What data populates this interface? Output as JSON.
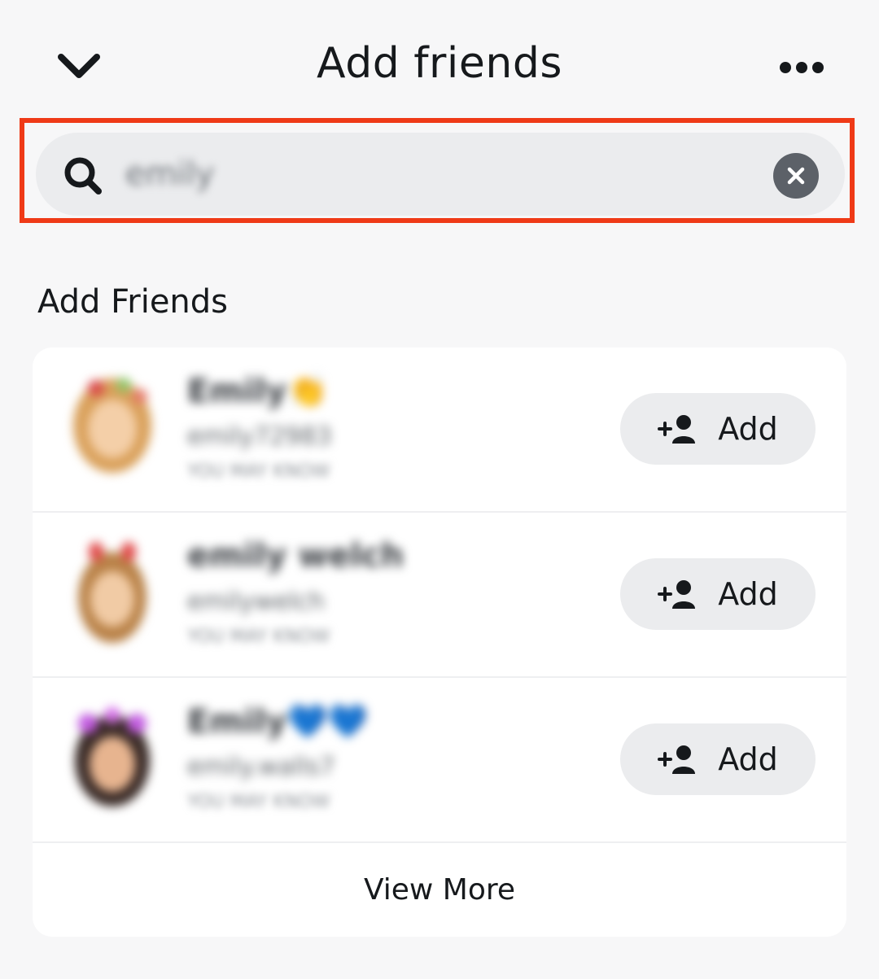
{
  "header": {
    "title": "Add friends",
    "back_icon": "chevron-down-icon",
    "more_icon": "more-horizontal-icon"
  },
  "search": {
    "value": "emily",
    "search_icon": "search-icon",
    "clear_icon": "clear-icon",
    "highlight_color": "#ef3a17"
  },
  "section": {
    "title": "Add Friends"
  },
  "results": [
    {
      "name": "Emily👏",
      "username": "emily72983",
      "meta": "YOU MAY KNOW",
      "add_label": "Add",
      "add_icon": "add-friend-icon"
    },
    {
      "name": "emily welch",
      "username": "emilywelch",
      "meta": "YOU MAY KNOW",
      "add_label": "Add",
      "add_icon": "add-friend-icon"
    },
    {
      "name": "Emily💙💙",
      "username": "emily.walls7",
      "meta": "YOU MAY KNOW",
      "add_label": "Add",
      "add_icon": "add-friend-icon"
    }
  ],
  "view_more_label": "View More",
  "colors": {
    "background": "#f7f7f8",
    "search_bg": "#ebecee",
    "button_bg": "#ebecee",
    "card_bg": "#ffffff",
    "text": "#16191c"
  }
}
